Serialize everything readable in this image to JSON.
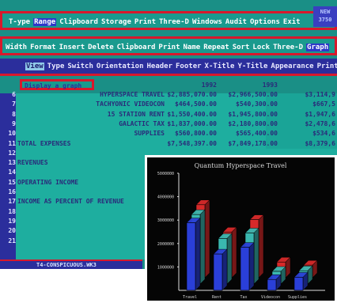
{
  "menu": {
    "row1": [
      "T-ype",
      "Range",
      "Clipboard",
      "Storage",
      "Print",
      "Three-D",
      "Windows",
      "Audit",
      "Options",
      "Exit"
    ],
    "row2": [
      "Width",
      "Format",
      "Insert",
      "Delete",
      "Clipboard",
      "Print",
      "Name",
      "Repeat",
      "Sort",
      "Lock",
      "Three-D",
      "Graph"
    ],
    "row3": [
      "View",
      "Type",
      "Switch",
      "Orientation",
      "Header",
      "Footer",
      "X-Title",
      "Y-Title",
      "Appearance",
      "Print"
    ],
    "badge": "NEW 3750"
  },
  "prompt": "Display a graph",
  "sheet": {
    "years": [
      "1992",
      "1993"
    ],
    "rows": [
      {
        "num": "6",
        "label": "HYPERSPACE TRAVEL",
        "v1992": "$2,885,070.00",
        "v1993": "$2,966,500.00",
        "v1994": "$3,114,9"
      },
      {
        "num": "7",
        "label": "TACHYONIC VIDEOCON",
        "v1992": "$464,500.00",
        "v1993": "$540,300.00",
        "v1994": "$667,5"
      },
      {
        "num": "8",
        "label": "15 STATION RENT",
        "v1992": "$1,550,400.00",
        "v1993": "$1,945,800.00",
        "v1994": "$1,947,6"
      },
      {
        "num": "9",
        "label": "GALACTIC TAX",
        "v1992": "$1,837,000.00",
        "v1993": "$2,180,800.00",
        "v1994": "$2,478,6"
      },
      {
        "num": "10",
        "label": "SUPPLIES",
        "v1992": "$560,800.00",
        "v1993": "$565,400.00",
        "v1994": "$534,6"
      },
      {
        "num": "11",
        "label": "TOTAL EXPENSES",
        "v1992": "$7,548,397.00",
        "v1993": "$7,849,178.00",
        "v1994": "$8,379,6"
      },
      {
        "num": "12",
        "label": "",
        "v1992": "",
        "v1993": "",
        "v1994": ""
      },
      {
        "num": "13",
        "label": "REVENUES",
        "v1992": "",
        "v1993": "",
        "v1994": ""
      },
      {
        "num": "14",
        "label": "",
        "v1992": "",
        "v1993": "",
        "v1994": ""
      },
      {
        "num": "15",
        "label": "OPERATING INCOME",
        "v1992": "",
        "v1993": "",
        "v1994": ""
      },
      {
        "num": "16",
        "label": "",
        "v1992": "",
        "v1993": "",
        "v1994": ""
      },
      {
        "num": "17",
        "label": "INCOME AS PERCENT OF REVENUE",
        "v1992": "",
        "v1993": "",
        "v1994": ""
      },
      {
        "num": "18",
        "label": "",
        "v1992": "",
        "v1993": "",
        "v1994": ""
      },
      {
        "num": "19",
        "label": "",
        "v1992": "",
        "v1993": "",
        "v1994": ""
      },
      {
        "num": "20",
        "label": "",
        "v1992": "",
        "v1993": "",
        "v1994": ""
      },
      {
        "num": "21",
        "label": "",
        "v1992": "",
        "v1993": "",
        "v1994": ""
      }
    ]
  },
  "status_text": "T4-CONSPICUOUS.WK3",
  "chart_data": {
    "type": "bar",
    "title": "Quantum Hyperspace Travel",
    "categories": [
      "Travel",
      "Rent",
      "Tax",
      "Videocon",
      "Supplies"
    ],
    "series": [
      {
        "values": [
          2885070,
          1550400,
          1837000,
          464500,
          560800
        ],
        "color": "#2a3fd8"
      },
      {
        "values": [
          2966500,
          1945800,
          2180800,
          540300,
          565400
        ],
        "color": "#3ab8b0"
      },
      {
        "values": [
          3114900,
          1947600,
          2478600,
          667500,
          534600
        ],
        "color": "#d82a2a"
      }
    ],
    "ytick_labels": [
      "1000000",
      "2000000",
      "3000000",
      "4000000",
      "5000000"
    ],
    "ylim": [
      0,
      5000000
    ],
    "grid": false,
    "legend": "none"
  }
}
